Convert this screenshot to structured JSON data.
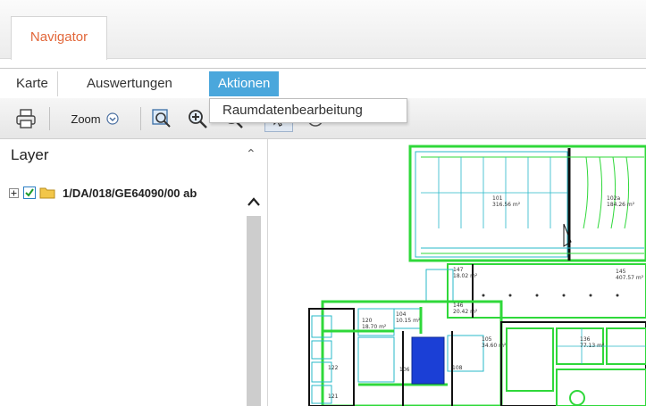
{
  "tabs": {
    "navigator_label": "Navigator"
  },
  "menu": {
    "items": [
      {
        "label": "Karte"
      },
      {
        "label": "Auswertungen"
      },
      {
        "label": "Aktionen"
      }
    ],
    "dropdown_item": "Raumdatenbearbeitung"
  },
  "toolbar": {
    "zoom_label": "Zoom",
    "icons": [
      "print-icon",
      "zoom-dropdown-icon",
      "zoom-window-icon",
      "zoom-in-icon",
      "zoom-out-icon",
      "select-icon",
      "identify-icon"
    ]
  },
  "layer_panel": {
    "title": "Layer",
    "tree": [
      {
        "label": "1/DA/018/GE64090/00 ab",
        "checked": true
      }
    ]
  },
  "map": {
    "rooms": [
      {
        "label": "101",
        "area": "316.56 m²"
      },
      {
        "label": "102a",
        "area": "184.26 m²"
      },
      {
        "label": "147",
        "area": "18.02 m²"
      },
      {
        "label": "145",
        "area": "407.57 m²"
      },
      {
        "label": "146",
        "area": "20.42 m²"
      },
      {
        "label": "104",
        "area": "10.15 m²"
      },
      {
        "label": "105",
        "area": "34.60 m²"
      },
      {
        "label": "136",
        "area": "77.13 m²"
      },
      {
        "label": "120",
        "area": "18.70 m²"
      },
      {
        "label": "122",
        "area": ""
      },
      {
        "label": "106",
        "area": ""
      },
      {
        "label": "108",
        "area": ""
      },
      {
        "label": "121",
        "area": ""
      }
    ],
    "colors": {
      "wall": "#2fd83a",
      "grid": "#27b8c9",
      "selected": "#1b3fd6"
    }
  }
}
